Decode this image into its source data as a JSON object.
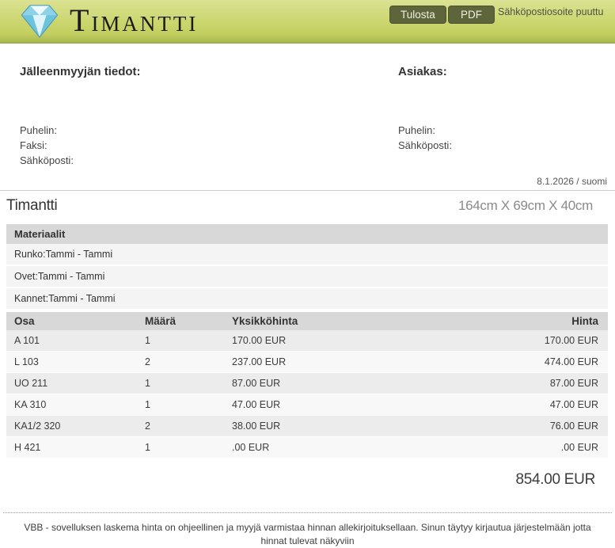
{
  "header": {
    "logo_text": "Timantti",
    "print_button": "Tulosta",
    "pdf_button": "PDF",
    "email_missing": "Sähköpostiosoite puuttu"
  },
  "reseller": {
    "title": "Jälleenmyyjän tiedot:",
    "phone_label": "Puhelin:",
    "fax_label": "Faksi:",
    "email_label": "Sähköposti:"
  },
  "customer": {
    "title": "Asiakas:",
    "phone_label": "Puhelin:",
    "email_label": "Sähköposti:"
  },
  "meta": {
    "date_locale": "8.1.2026 / suomi"
  },
  "product": {
    "name": "Timantti",
    "dimensions": "164cm X 69cm X 40cm"
  },
  "materials": {
    "title": "Materiaalit",
    "rows": [
      "Runko:Tammi - Tammi",
      "Ovet:Tammi - Tammi",
      "Kannet:Tammi - Tammi"
    ]
  },
  "parts_table": {
    "headers": [
      "Osa",
      "Määrä",
      "Yksikköhinta",
      "Hinta"
    ],
    "rows": [
      {
        "osa": "A 101",
        "maara": "1",
        "yksikkohinta": "170.00 EUR",
        "hinta": "170.00 EUR"
      },
      {
        "osa": "L 103",
        "maara": "2",
        "yksikkohinta": "237.00 EUR",
        "hinta": "474.00 EUR"
      },
      {
        "osa": "UO 211",
        "maara": "1",
        "yksikkohinta": "87.00 EUR",
        "hinta": "87.00 EUR"
      },
      {
        "osa": "KA 310",
        "maara": "1",
        "yksikkohinta": "47.00 EUR",
        "hinta": "47.00 EUR"
      },
      {
        "osa": "KA1/2 320",
        "maara": "2",
        "yksikkohinta": "38.00 EUR",
        "hinta": "76.00 EUR"
      },
      {
        "osa": "H 421",
        "maara": "1",
        "yksikkohinta": ".00 EUR",
        "hinta": ".00 EUR"
      }
    ]
  },
  "total": "854.00 EUR",
  "footer": {
    "note": "VBB - sovelluksen laskema hinta on ohjeellinen ja myyjä varmistaa hinnan allekirjoituksellaan. Sinun täytyy kirjautua järjestelmään jotta hinnat tulevat näkyviin"
  },
  "colors": {
    "header_green": "#c8d26a",
    "header_border": "#9aa74a",
    "button_bg": "#5f653a",
    "bar_gray": "#d8d8d8",
    "row_gray": "#ececec"
  }
}
